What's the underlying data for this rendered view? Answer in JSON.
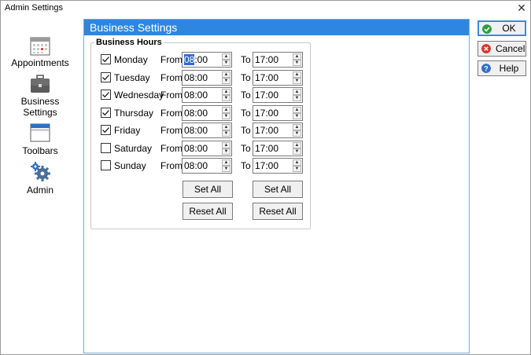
{
  "window": {
    "title": "Admin Settings",
    "close": "✕"
  },
  "nav": {
    "items": [
      {
        "label": "Appointments",
        "icon": "calendar-icon"
      },
      {
        "label_line1": "Business",
        "label_line2": "Settings",
        "icon": "briefcase-icon"
      },
      {
        "label": "Toolbars",
        "icon": "toolbar-window-icon"
      },
      {
        "label": "Admin",
        "icon": "gears-icon"
      }
    ]
  },
  "panel": {
    "header": "Business Settings",
    "group_title": "Business Hours",
    "from_label": "From",
    "to_label": "To",
    "days": [
      {
        "name": "Monday",
        "checked": true,
        "from": "08:00",
        "to": "17:00"
      },
      {
        "name": "Tuesday",
        "checked": true,
        "from": "08:00",
        "to": "17:00"
      },
      {
        "name": "Wednesday",
        "checked": true,
        "from": "08:00",
        "to": "17:00"
      },
      {
        "name": "Thursday",
        "checked": true,
        "from": "08:00",
        "to": "17:00"
      },
      {
        "name": "Friday",
        "checked": true,
        "from": "08:00",
        "to": "17:00"
      },
      {
        "name": "Saturday",
        "checked": false,
        "from": "08:00",
        "to": "17:00"
      },
      {
        "name": "Sunday",
        "checked": false,
        "from": "08:00",
        "to": "17:00"
      }
    ],
    "set_all_label": "Set All",
    "reset_all_label": "Reset All"
  },
  "buttons": {
    "ok": "OK",
    "cancel": "Cancel",
    "help": "Help"
  },
  "colors": {
    "accent": "#2f86e0",
    "ok_icon": "#2e9e3e",
    "cancel_icon": "#d9342b",
    "help_icon": "#2f6fc4"
  }
}
